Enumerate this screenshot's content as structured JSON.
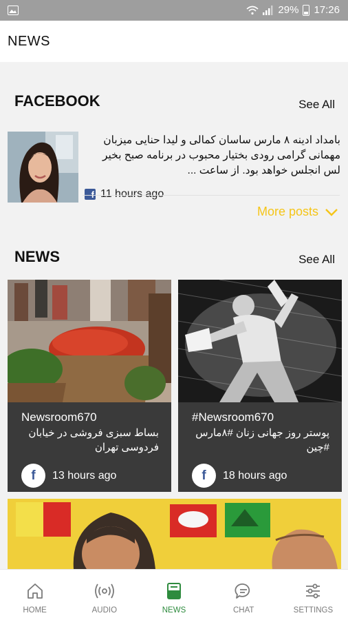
{
  "status_bar": {
    "battery": "29%",
    "time": "17:26"
  },
  "app_bar": {
    "title": "NEWS"
  },
  "facebook": {
    "title": "FACEBOOK",
    "see_all": "See All",
    "post": {
      "text": "بامداد ادینه ۸ مارس ساسان کمالی و لیدا حنایی میزبان مهمانی گرامی رودی بختیار محبوب در برنامه صبح بخیر لس انجلس خواهد بود. از ساعت ...",
      "time": "11 hours ago"
    },
    "more_posts": "More posts"
  },
  "news": {
    "title": "NEWS",
    "see_all": "See All",
    "cards": [
      {
        "author": "Newsroom670",
        "headline": "بساط سبزی فروشی در خیابان فردوسی تهران",
        "time": "13 hours ago"
      },
      {
        "author": "#Newsroom670",
        "headline": "پوستر روز جهانی زنان #۸مارس #چین",
        "time": "18 hours ago"
      }
    ]
  },
  "bottom_nav": [
    {
      "label": "HOME",
      "icon": "home-icon"
    },
    {
      "label": "AUDIO",
      "icon": "radio-icon"
    },
    {
      "label": "NEWS",
      "icon": "news-icon",
      "active": true
    },
    {
      "label": "CHAT",
      "icon": "chat-icon"
    },
    {
      "label": "SETTINGS",
      "icon": "settings-sliders-icon"
    }
  ],
  "colors": {
    "accent": "#2e8b3e",
    "more_posts": "#f5c518",
    "card_bg": "#3a3a3a",
    "facebook": "#3b5998"
  }
}
